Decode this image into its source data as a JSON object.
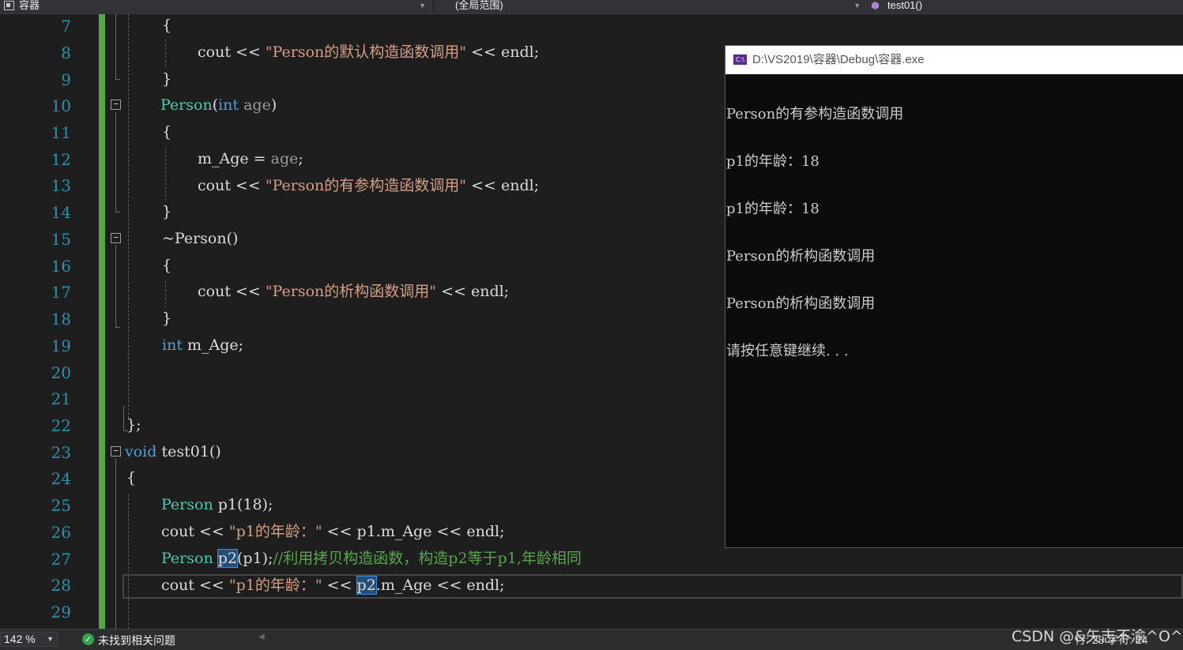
{
  "navbar": {
    "project": "容器",
    "scope": "(全局范围)",
    "member": "test01()"
  },
  "editor": {
    "lines": [
      {
        "n": "7"
      },
      {
        "n": "8"
      },
      {
        "n": "9"
      },
      {
        "n": "10"
      },
      {
        "n": "11"
      },
      {
        "n": "12"
      },
      {
        "n": "13"
      },
      {
        "n": "14"
      },
      {
        "n": "15"
      },
      {
        "n": "16"
      },
      {
        "n": "17"
      },
      {
        "n": "18"
      },
      {
        "n": "19"
      },
      {
        "n": "20"
      },
      {
        "n": "21"
      },
      {
        "n": "22"
      },
      {
        "n": "23"
      },
      {
        "n": "24"
      },
      {
        "n": "25"
      },
      {
        "n": "26"
      },
      {
        "n": "27"
      },
      {
        "n": "28"
      },
      {
        "n": "29"
      }
    ],
    "code": {
      "l7_brace": "{",
      "l8_cout": "cout << ",
      "l8_str": "\"Person的默认构造函数调用\"",
      "l8_end": " << endl;",
      "l9_brace": "}",
      "l10_name": "Person",
      "l10_open": "(",
      "l10_int": "int",
      "l10_param": " age",
      "l10_close": ")",
      "l11_brace": "{",
      "l12_member": "m_Age = ",
      "l12_param": "age",
      "l12_semi": ";",
      "l13_cout": "cout << ",
      "l13_str": "\"Person的有参构造函数调用\"",
      "l13_end": " << endl;",
      "l14_brace": "}",
      "l15_name": "~Person()",
      "l16_brace": "{",
      "l17_cout": "cout << ",
      "l17_str": "\"Person的析构函数调用\"",
      "l17_end": " << endl;",
      "l18_brace": "}",
      "l19_int": "int",
      "l19_rest": " m_Age;",
      "l22_close": "};",
      "l23_void": "void",
      "l23_rest": " test01()",
      "l24_brace": "{",
      "l25_type": "Person",
      "l25_rest": " p1(18);",
      "l26_cout": "cout << ",
      "l26_str": "\"p1的年龄：\"",
      "l26_end": " << p1.m_Age << endl;",
      "l27_type": "Person",
      "l27_sp": " ",
      "l27_sel": "p2",
      "l27_rest": "(p1);",
      "l27_comment": "//利用拷贝构造函数，构造p2等于p1,年龄相同",
      "l28_cout": "cout << ",
      "l28_str": "\"p1的年龄：\"",
      "l28_mid": " << ",
      "l28_sel": "p2",
      "l28_end": ".m_Age << endl;"
    }
  },
  "console": {
    "title": "D:\\VS2019\\容器\\Debug\\容器.exe",
    "icon_label": "C:\\",
    "output": [
      "Person的有参构造函数调用",
      "p1的年龄：18",
      "p1的年龄：18",
      "Person的析构函数调用",
      "Person的析构函数调用",
      "请按任意键继续. . ."
    ]
  },
  "statusbar": {
    "zoom": "142 %",
    "issues": "未找到相关问题",
    "position": "行: 28     字符: 24"
  },
  "watermark": "CSDN @&矢志不渝^O^"
}
